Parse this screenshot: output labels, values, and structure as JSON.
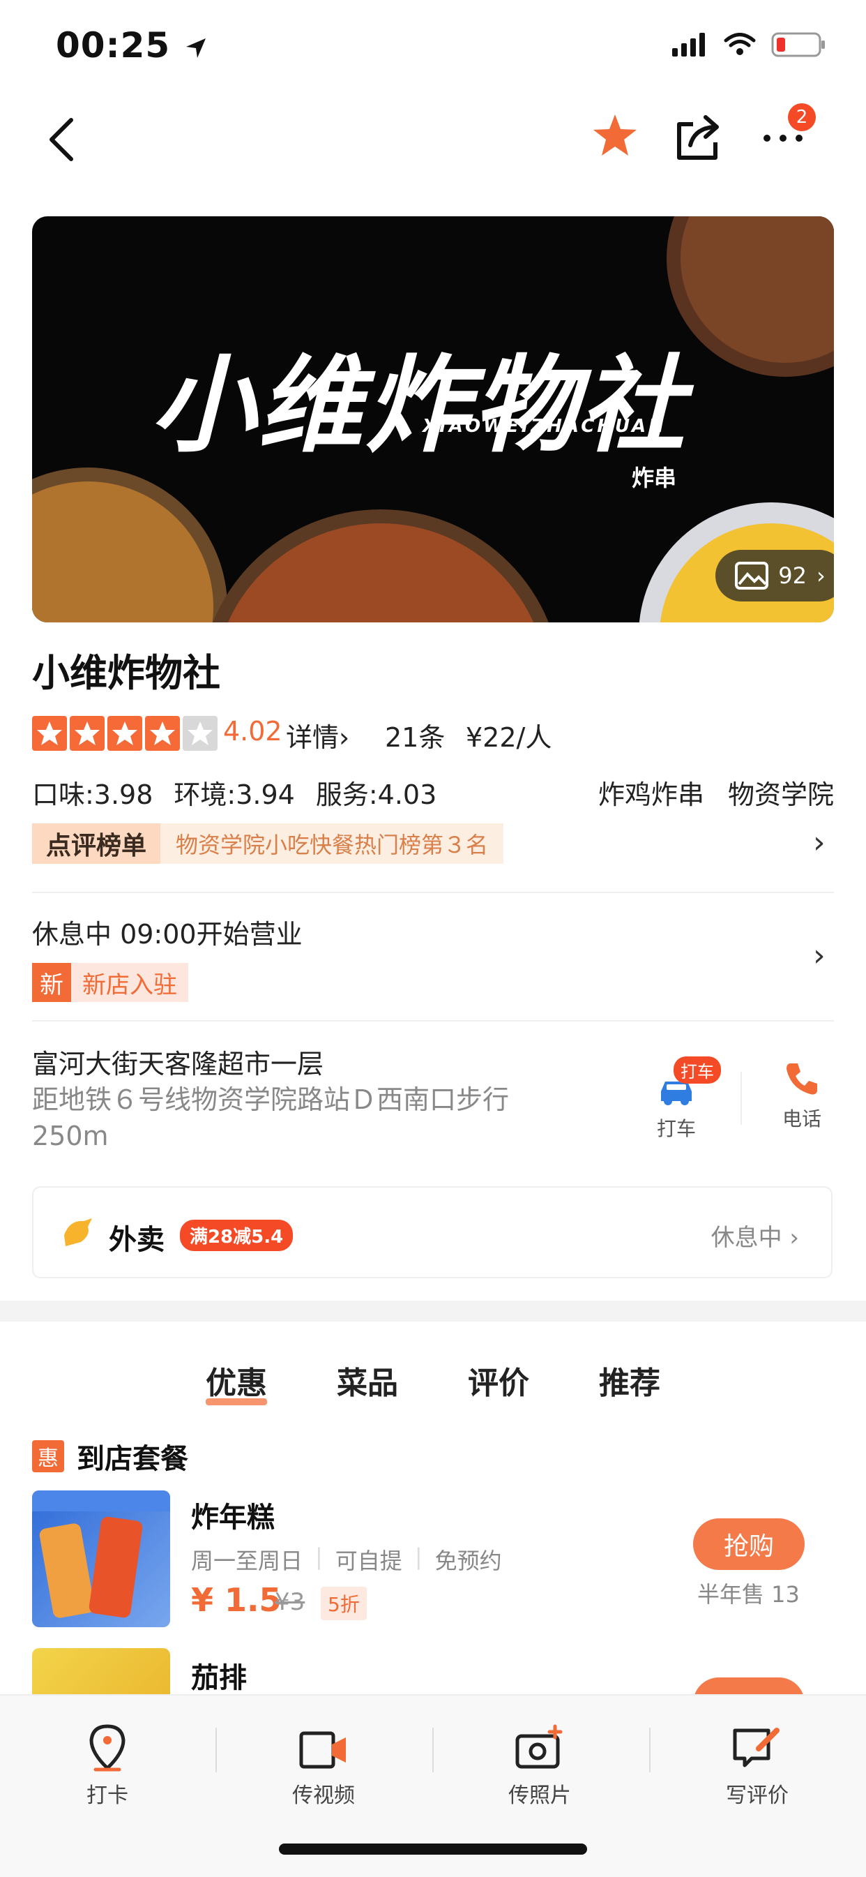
{
  "status_bar": {
    "time": "00:25"
  },
  "nav": {
    "more_badge": "2"
  },
  "banner": {
    "title": "小维炸物社",
    "subtitle": "XIAOWEIZHACHUAN",
    "small_text": "炸串",
    "photo_count": "92"
  },
  "shop": {
    "name": "小维炸物社",
    "stars": 4,
    "rating": "4.02",
    "detail_link": "详情",
    "review_count": "21条",
    "price_per_person": "¥22/人",
    "subscores": [
      "口味:3.98",
      "环境:3.94",
      "服务:4.03"
    ],
    "category": "炸鸡炸串",
    "area": "物资学院",
    "ranking_tag": "点评榜单",
    "ranking_text": "物资学院小吃快餐热门榜第３名",
    "hours": "休息中  09:00开始营业",
    "new_tag": "新",
    "new_text": "新店入驻",
    "address": "富河大街天客隆超市一层",
    "distance": "距地铁６号线物资学院路站Ｄ西南口步行250m",
    "taxi_badge": "打车",
    "taxi_label": "打车",
    "phone_label": "电话"
  },
  "delivery": {
    "label": "外卖",
    "promo": "满28减5.4",
    "status": "休息中"
  },
  "tabs": [
    {
      "label": "优惠",
      "active": true
    },
    {
      "label": "菜品",
      "active": false
    },
    {
      "label": "评价",
      "active": false
    },
    {
      "label": "推荐",
      "active": false
    }
  ],
  "deals_section": {
    "icon_label": "惠",
    "title": "到店套餐",
    "items": [
      {
        "name": "炸年糕",
        "tags": [
          "周一至周日",
          "可自提",
          "免预约"
        ],
        "price": "¥ 1.5",
        "original": "¥3",
        "discount": "5折",
        "button": "抢购",
        "sold": "半年售 13"
      },
      {
        "name": "茄排"
      }
    ]
  },
  "bottom_bar": [
    {
      "label": "打卡",
      "icon": "location-pin-icon"
    },
    {
      "label": "传视频",
      "icon": "video-upload-icon"
    },
    {
      "label": "传照片",
      "icon": "camera-upload-icon"
    },
    {
      "label": "写评价",
      "icon": "write-review-icon"
    }
  ],
  "colors": {
    "accent": "#f26a35",
    "badge": "#f44a26"
  }
}
